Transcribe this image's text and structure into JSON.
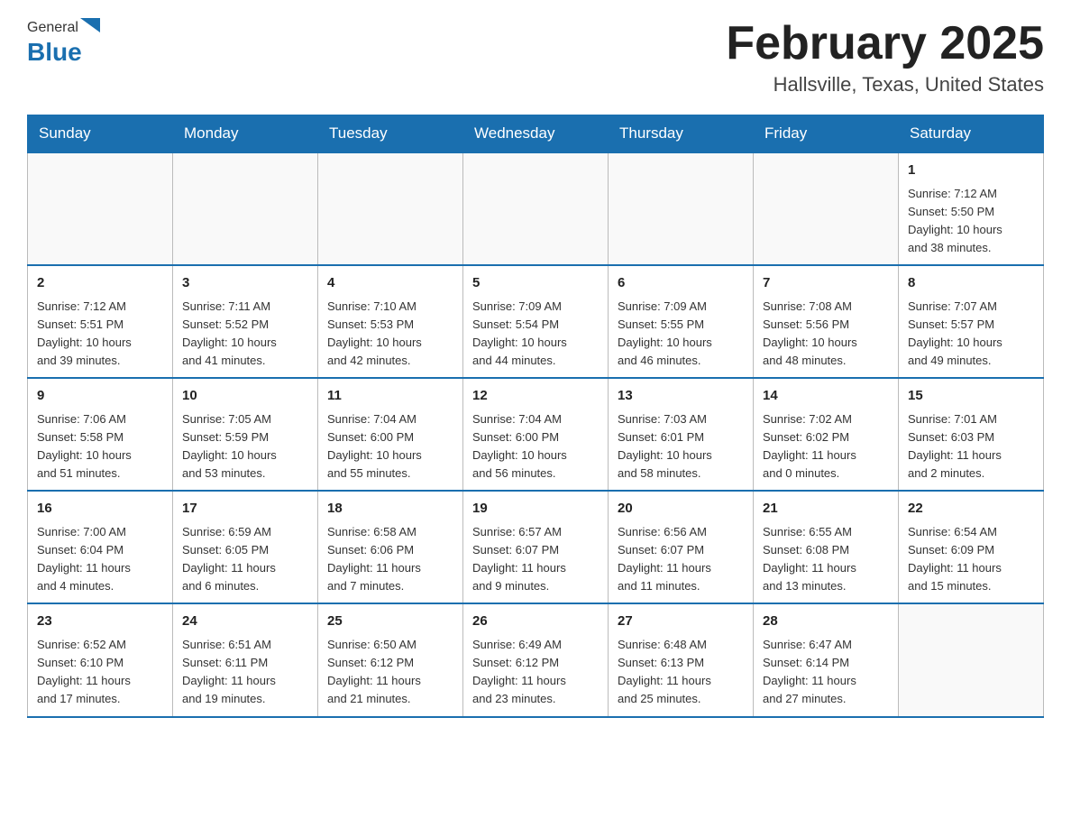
{
  "header": {
    "logo_general": "General",
    "logo_blue": "Blue",
    "month_title": "February 2025",
    "location": "Hallsville, Texas, United States"
  },
  "weekdays": [
    "Sunday",
    "Monday",
    "Tuesday",
    "Wednesday",
    "Thursday",
    "Friday",
    "Saturday"
  ],
  "weeks": [
    [
      {
        "day": "",
        "info": ""
      },
      {
        "day": "",
        "info": ""
      },
      {
        "day": "",
        "info": ""
      },
      {
        "day": "",
        "info": ""
      },
      {
        "day": "",
        "info": ""
      },
      {
        "day": "",
        "info": ""
      },
      {
        "day": "1",
        "info": "Sunrise: 7:12 AM\nSunset: 5:50 PM\nDaylight: 10 hours\nand 38 minutes."
      }
    ],
    [
      {
        "day": "2",
        "info": "Sunrise: 7:12 AM\nSunset: 5:51 PM\nDaylight: 10 hours\nand 39 minutes."
      },
      {
        "day": "3",
        "info": "Sunrise: 7:11 AM\nSunset: 5:52 PM\nDaylight: 10 hours\nand 41 minutes."
      },
      {
        "day": "4",
        "info": "Sunrise: 7:10 AM\nSunset: 5:53 PM\nDaylight: 10 hours\nand 42 minutes."
      },
      {
        "day": "5",
        "info": "Sunrise: 7:09 AM\nSunset: 5:54 PM\nDaylight: 10 hours\nand 44 minutes."
      },
      {
        "day": "6",
        "info": "Sunrise: 7:09 AM\nSunset: 5:55 PM\nDaylight: 10 hours\nand 46 minutes."
      },
      {
        "day": "7",
        "info": "Sunrise: 7:08 AM\nSunset: 5:56 PM\nDaylight: 10 hours\nand 48 minutes."
      },
      {
        "day": "8",
        "info": "Sunrise: 7:07 AM\nSunset: 5:57 PM\nDaylight: 10 hours\nand 49 minutes."
      }
    ],
    [
      {
        "day": "9",
        "info": "Sunrise: 7:06 AM\nSunset: 5:58 PM\nDaylight: 10 hours\nand 51 minutes."
      },
      {
        "day": "10",
        "info": "Sunrise: 7:05 AM\nSunset: 5:59 PM\nDaylight: 10 hours\nand 53 minutes."
      },
      {
        "day": "11",
        "info": "Sunrise: 7:04 AM\nSunset: 6:00 PM\nDaylight: 10 hours\nand 55 minutes."
      },
      {
        "day": "12",
        "info": "Sunrise: 7:04 AM\nSunset: 6:00 PM\nDaylight: 10 hours\nand 56 minutes."
      },
      {
        "day": "13",
        "info": "Sunrise: 7:03 AM\nSunset: 6:01 PM\nDaylight: 10 hours\nand 58 minutes."
      },
      {
        "day": "14",
        "info": "Sunrise: 7:02 AM\nSunset: 6:02 PM\nDaylight: 11 hours\nand 0 minutes."
      },
      {
        "day": "15",
        "info": "Sunrise: 7:01 AM\nSunset: 6:03 PM\nDaylight: 11 hours\nand 2 minutes."
      }
    ],
    [
      {
        "day": "16",
        "info": "Sunrise: 7:00 AM\nSunset: 6:04 PM\nDaylight: 11 hours\nand 4 minutes."
      },
      {
        "day": "17",
        "info": "Sunrise: 6:59 AM\nSunset: 6:05 PM\nDaylight: 11 hours\nand 6 minutes."
      },
      {
        "day": "18",
        "info": "Sunrise: 6:58 AM\nSunset: 6:06 PM\nDaylight: 11 hours\nand 7 minutes."
      },
      {
        "day": "19",
        "info": "Sunrise: 6:57 AM\nSunset: 6:07 PM\nDaylight: 11 hours\nand 9 minutes."
      },
      {
        "day": "20",
        "info": "Sunrise: 6:56 AM\nSunset: 6:07 PM\nDaylight: 11 hours\nand 11 minutes."
      },
      {
        "day": "21",
        "info": "Sunrise: 6:55 AM\nSunset: 6:08 PM\nDaylight: 11 hours\nand 13 minutes."
      },
      {
        "day": "22",
        "info": "Sunrise: 6:54 AM\nSunset: 6:09 PM\nDaylight: 11 hours\nand 15 minutes."
      }
    ],
    [
      {
        "day": "23",
        "info": "Sunrise: 6:52 AM\nSunset: 6:10 PM\nDaylight: 11 hours\nand 17 minutes."
      },
      {
        "day": "24",
        "info": "Sunrise: 6:51 AM\nSunset: 6:11 PM\nDaylight: 11 hours\nand 19 minutes."
      },
      {
        "day": "25",
        "info": "Sunrise: 6:50 AM\nSunset: 6:12 PM\nDaylight: 11 hours\nand 21 minutes."
      },
      {
        "day": "26",
        "info": "Sunrise: 6:49 AM\nSunset: 6:12 PM\nDaylight: 11 hours\nand 23 minutes."
      },
      {
        "day": "27",
        "info": "Sunrise: 6:48 AM\nSunset: 6:13 PM\nDaylight: 11 hours\nand 25 minutes."
      },
      {
        "day": "28",
        "info": "Sunrise: 6:47 AM\nSunset: 6:14 PM\nDaylight: 11 hours\nand 27 minutes."
      },
      {
        "day": "",
        "info": ""
      }
    ]
  ]
}
